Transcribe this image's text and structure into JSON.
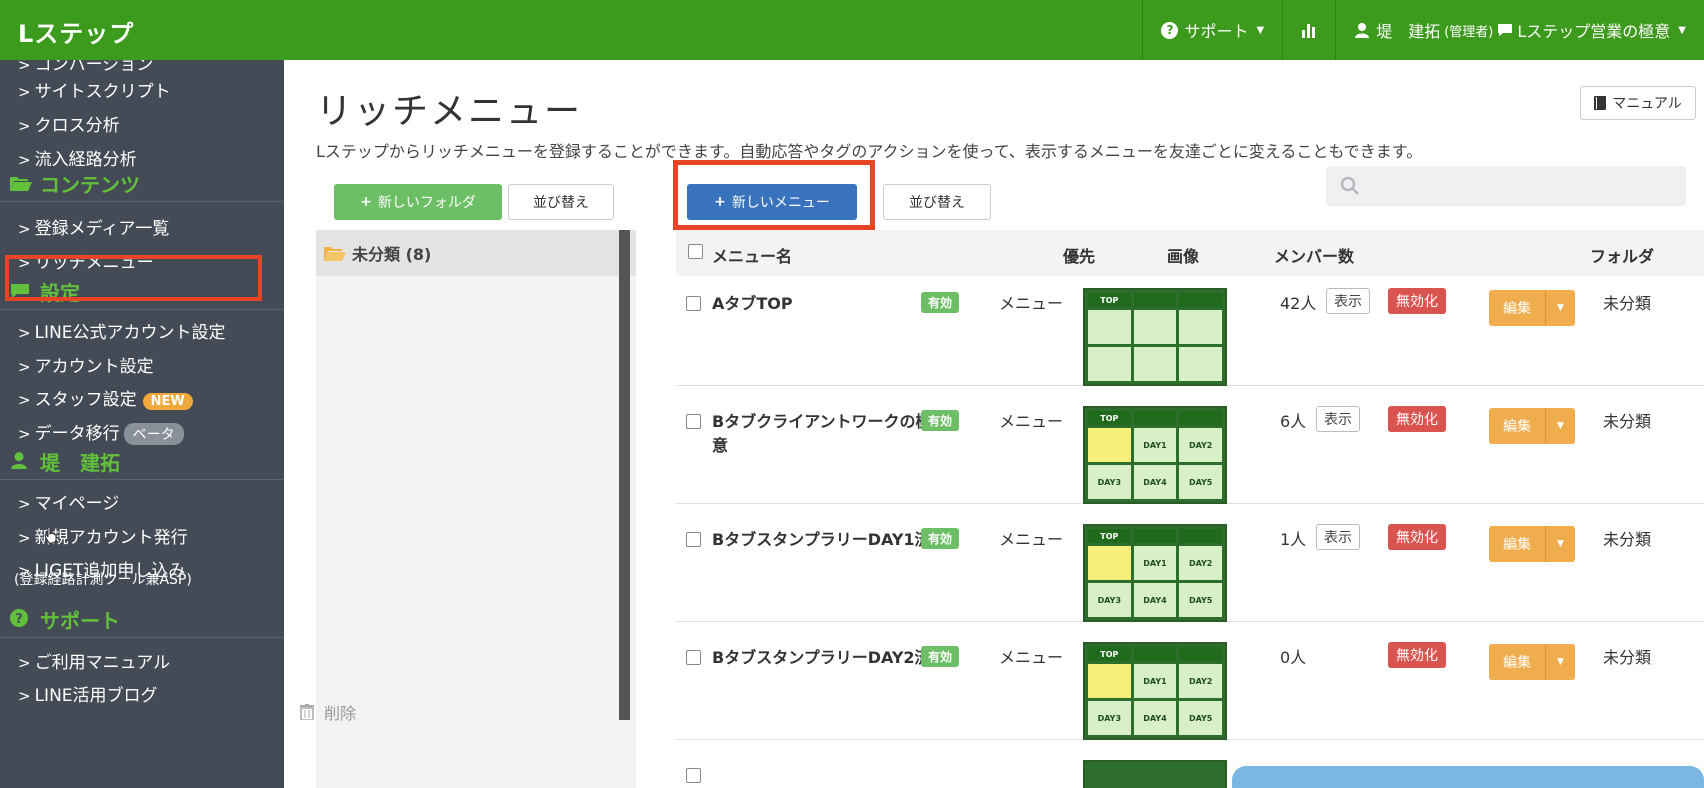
{
  "app": {
    "brand": "Lステップ"
  },
  "topnav": {
    "support": "サポート",
    "user_name": "堤　建拓",
    "user_role": "(管理者)",
    "account": "Lステップ営業の極意"
  },
  "sidebar": {
    "items_top": [
      "コンバージョン",
      "サイトスクリプト",
      "クロス分析",
      "流入経路分析"
    ],
    "section_contents": "コンテンツ",
    "items_contents": [
      "登録メディア一覧",
      "リッチメニュー"
    ],
    "section_settings": "設定",
    "items_settings": [
      "LINE公式アカウント設定",
      "アカウント設定",
      "スタッフ設定",
      "データ移行"
    ],
    "badge_new": "NEW",
    "badge_beta": "ベータ",
    "section_user": "堤　建拓",
    "items_user": [
      "マイページ",
      "新規アカウント発行",
      "LIGET追加申し込み"
    ],
    "liget_sub": "(登録経路計測ツール兼ASP)",
    "section_support": "サポート",
    "items_support": [
      "ご利用マニュアル",
      "LINE活用ブログ"
    ]
  },
  "main": {
    "title": "リッチメニュー",
    "description": "Lステップからリッチメニューを登録することができます。自動応答やタグのアクションを使って、表示するメニューを友達ごとに変えることもできます。",
    "manual_button": "マニュアル",
    "new_folder_button": "新しいフォルダ",
    "sort_button": "並び替え",
    "new_menu_button": "新しいメニュー",
    "sort_button_2": "並び替え",
    "folder_label": "未分類 (8)",
    "delete_label": "削除"
  },
  "table": {
    "headers": {
      "name": "メニュー名",
      "priority": "優先",
      "image": "画像",
      "members": "メンバー数",
      "folder": "フォルダ"
    },
    "rows": [
      {
        "name": "AタブTOP",
        "status": "有効",
        "type": "メニュー",
        "members": "42人",
        "show": "表示",
        "disable": "無効化",
        "edit": "編集",
        "folder": "未分類"
      },
      {
        "name": "Bタブクライアントワークの極意",
        "status": "有効",
        "type": "メニュー",
        "members": "6人",
        "show": "表示",
        "disable": "無効化",
        "edit": "編集",
        "folder": "未分類"
      },
      {
        "name": "BタブスタンプラリーDAY1済",
        "status": "有効",
        "type": "メニュー",
        "members": "1人",
        "show": "表示",
        "disable": "無効化",
        "edit": "編集",
        "folder": "未分類"
      },
      {
        "name": "BタブスタンプラリーDAY2済",
        "status": "有効",
        "type": "メニュー",
        "members": "0人",
        "show": "",
        "disable": "無効化",
        "edit": "編集",
        "folder": "未分類"
      }
    ],
    "thumb_labels": {
      "top": "TOP",
      "day1": "DAY1",
      "day2": "DAY2",
      "day3": "DAY3",
      "day4": "DAY4",
      "day5": "DAY5"
    }
  },
  "colors": {
    "topbar": "#3c9a1c",
    "sidebar": "#454b56",
    "accent_green": "#62c13a",
    "highlight": "#e84527",
    "primary_blue": "#3a73bd",
    "danger": "#d9534f",
    "warning": "#efad4d"
  }
}
